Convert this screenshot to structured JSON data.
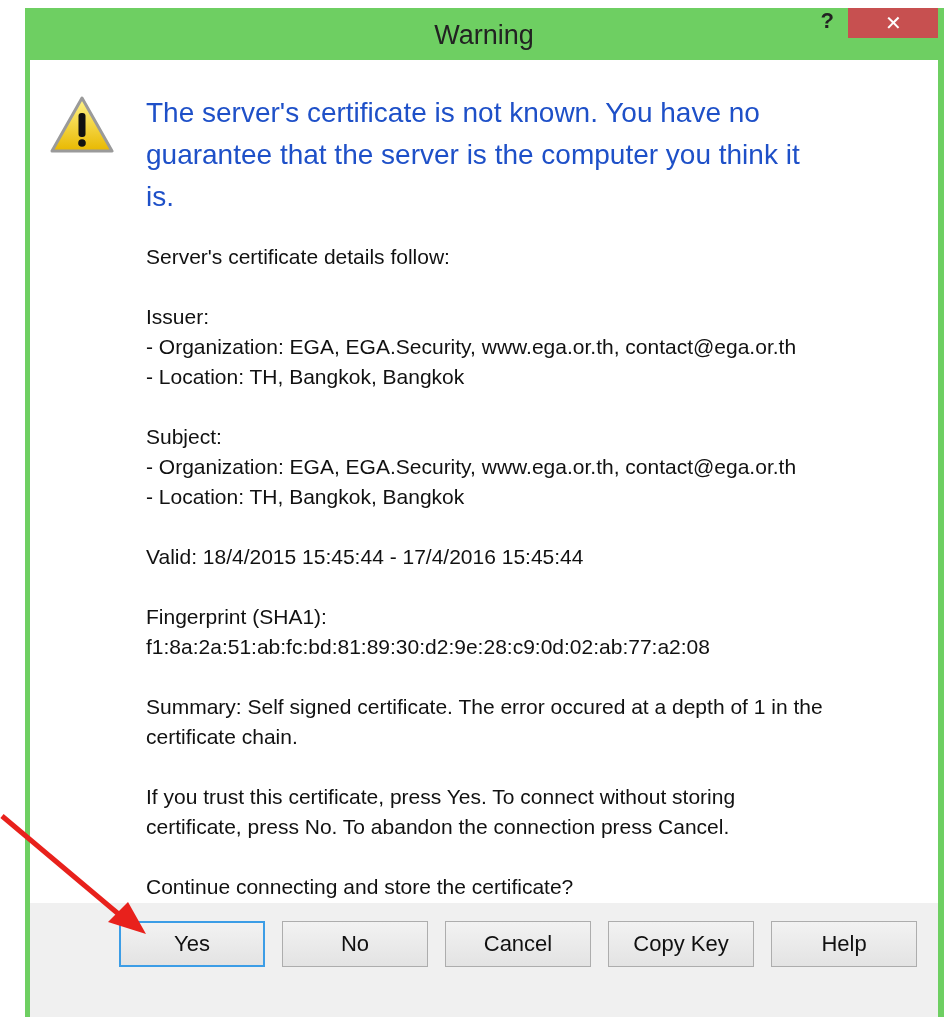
{
  "window": {
    "title": "Warning",
    "help": "?",
    "close": "✕"
  },
  "message": {
    "heading": "The server's certificate is not known. You have no guarantee that the server is the computer you think it is.",
    "paragraphs": [
      [
        "Server's certificate details follow:"
      ],
      [
        "Issuer:",
        "- Organization: EGA, EGA.Security, www.ega.or.th, contact@ega.or.th",
        "- Location: TH, Bangkok, Bangkok"
      ],
      [
        "Subject:",
        "- Organization: EGA, EGA.Security, www.ega.or.th, contact@ega.or.th",
        "- Location: TH, Bangkok, Bangkok"
      ],
      [
        "Valid: 18/4/2015 15:45:44 - 17/4/2016 15:45:44"
      ],
      [
        "Fingerprint (SHA1):",
        "f1:8a:2a:51:ab:fc:bd:81:89:30:d2:9e:28:c9:0d:02:ab:77:a2:08"
      ],
      [
        "Summary: Self signed certificate. The error occured at a depth of 1 in the certificate chain."
      ],
      [
        "If you trust this certificate, press Yes. To connect without storing certificate, press No. To abandon the connection press Cancel."
      ],
      [
        "Continue connecting and store the certificate?"
      ]
    ]
  },
  "buttons": [
    {
      "label": "Yes",
      "focused": true
    },
    {
      "label": "No",
      "focused": false
    },
    {
      "label": "Cancel",
      "focused": false
    },
    {
      "label": "Copy Key",
      "focused": false
    },
    {
      "label": "Help",
      "focused": false
    }
  ]
}
